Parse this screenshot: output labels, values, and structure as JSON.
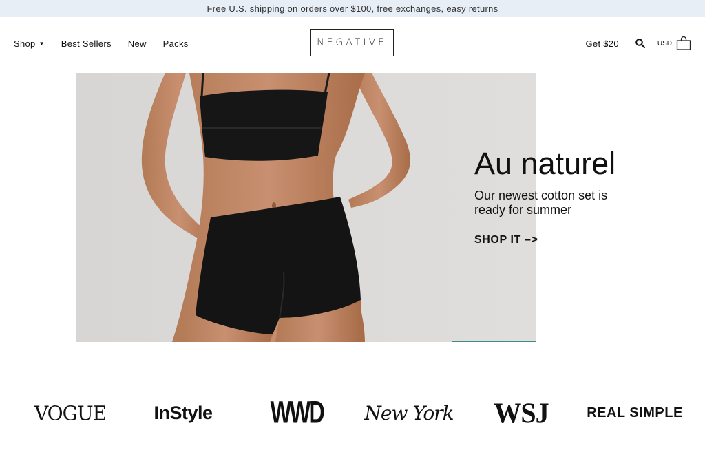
{
  "announcement": "Free U.S. shipping on orders over $100, free exchanges, easy returns",
  "nav": {
    "shop": "Shop",
    "best_sellers": "Best Sellers",
    "new": "New",
    "packs": "Packs",
    "logo": "NEGATIVE",
    "get20": "Get $20",
    "currency": "USD"
  },
  "hero": {
    "title": "Au naturel",
    "subtitle": "Our newest cotton set is ready for summer",
    "cta": "SHOP IT –>"
  },
  "press": {
    "vogue": "VOGUE",
    "instyle": "InStyle",
    "wwd": "WWD",
    "new_york": "New York",
    "wsj": "WSJ",
    "real_simple": "REAL SIMPLE"
  },
  "colors": {
    "announcement_bg": "#e8eef6",
    "hero_bg": "#dcdad8",
    "progress": "#3f8c8c"
  }
}
